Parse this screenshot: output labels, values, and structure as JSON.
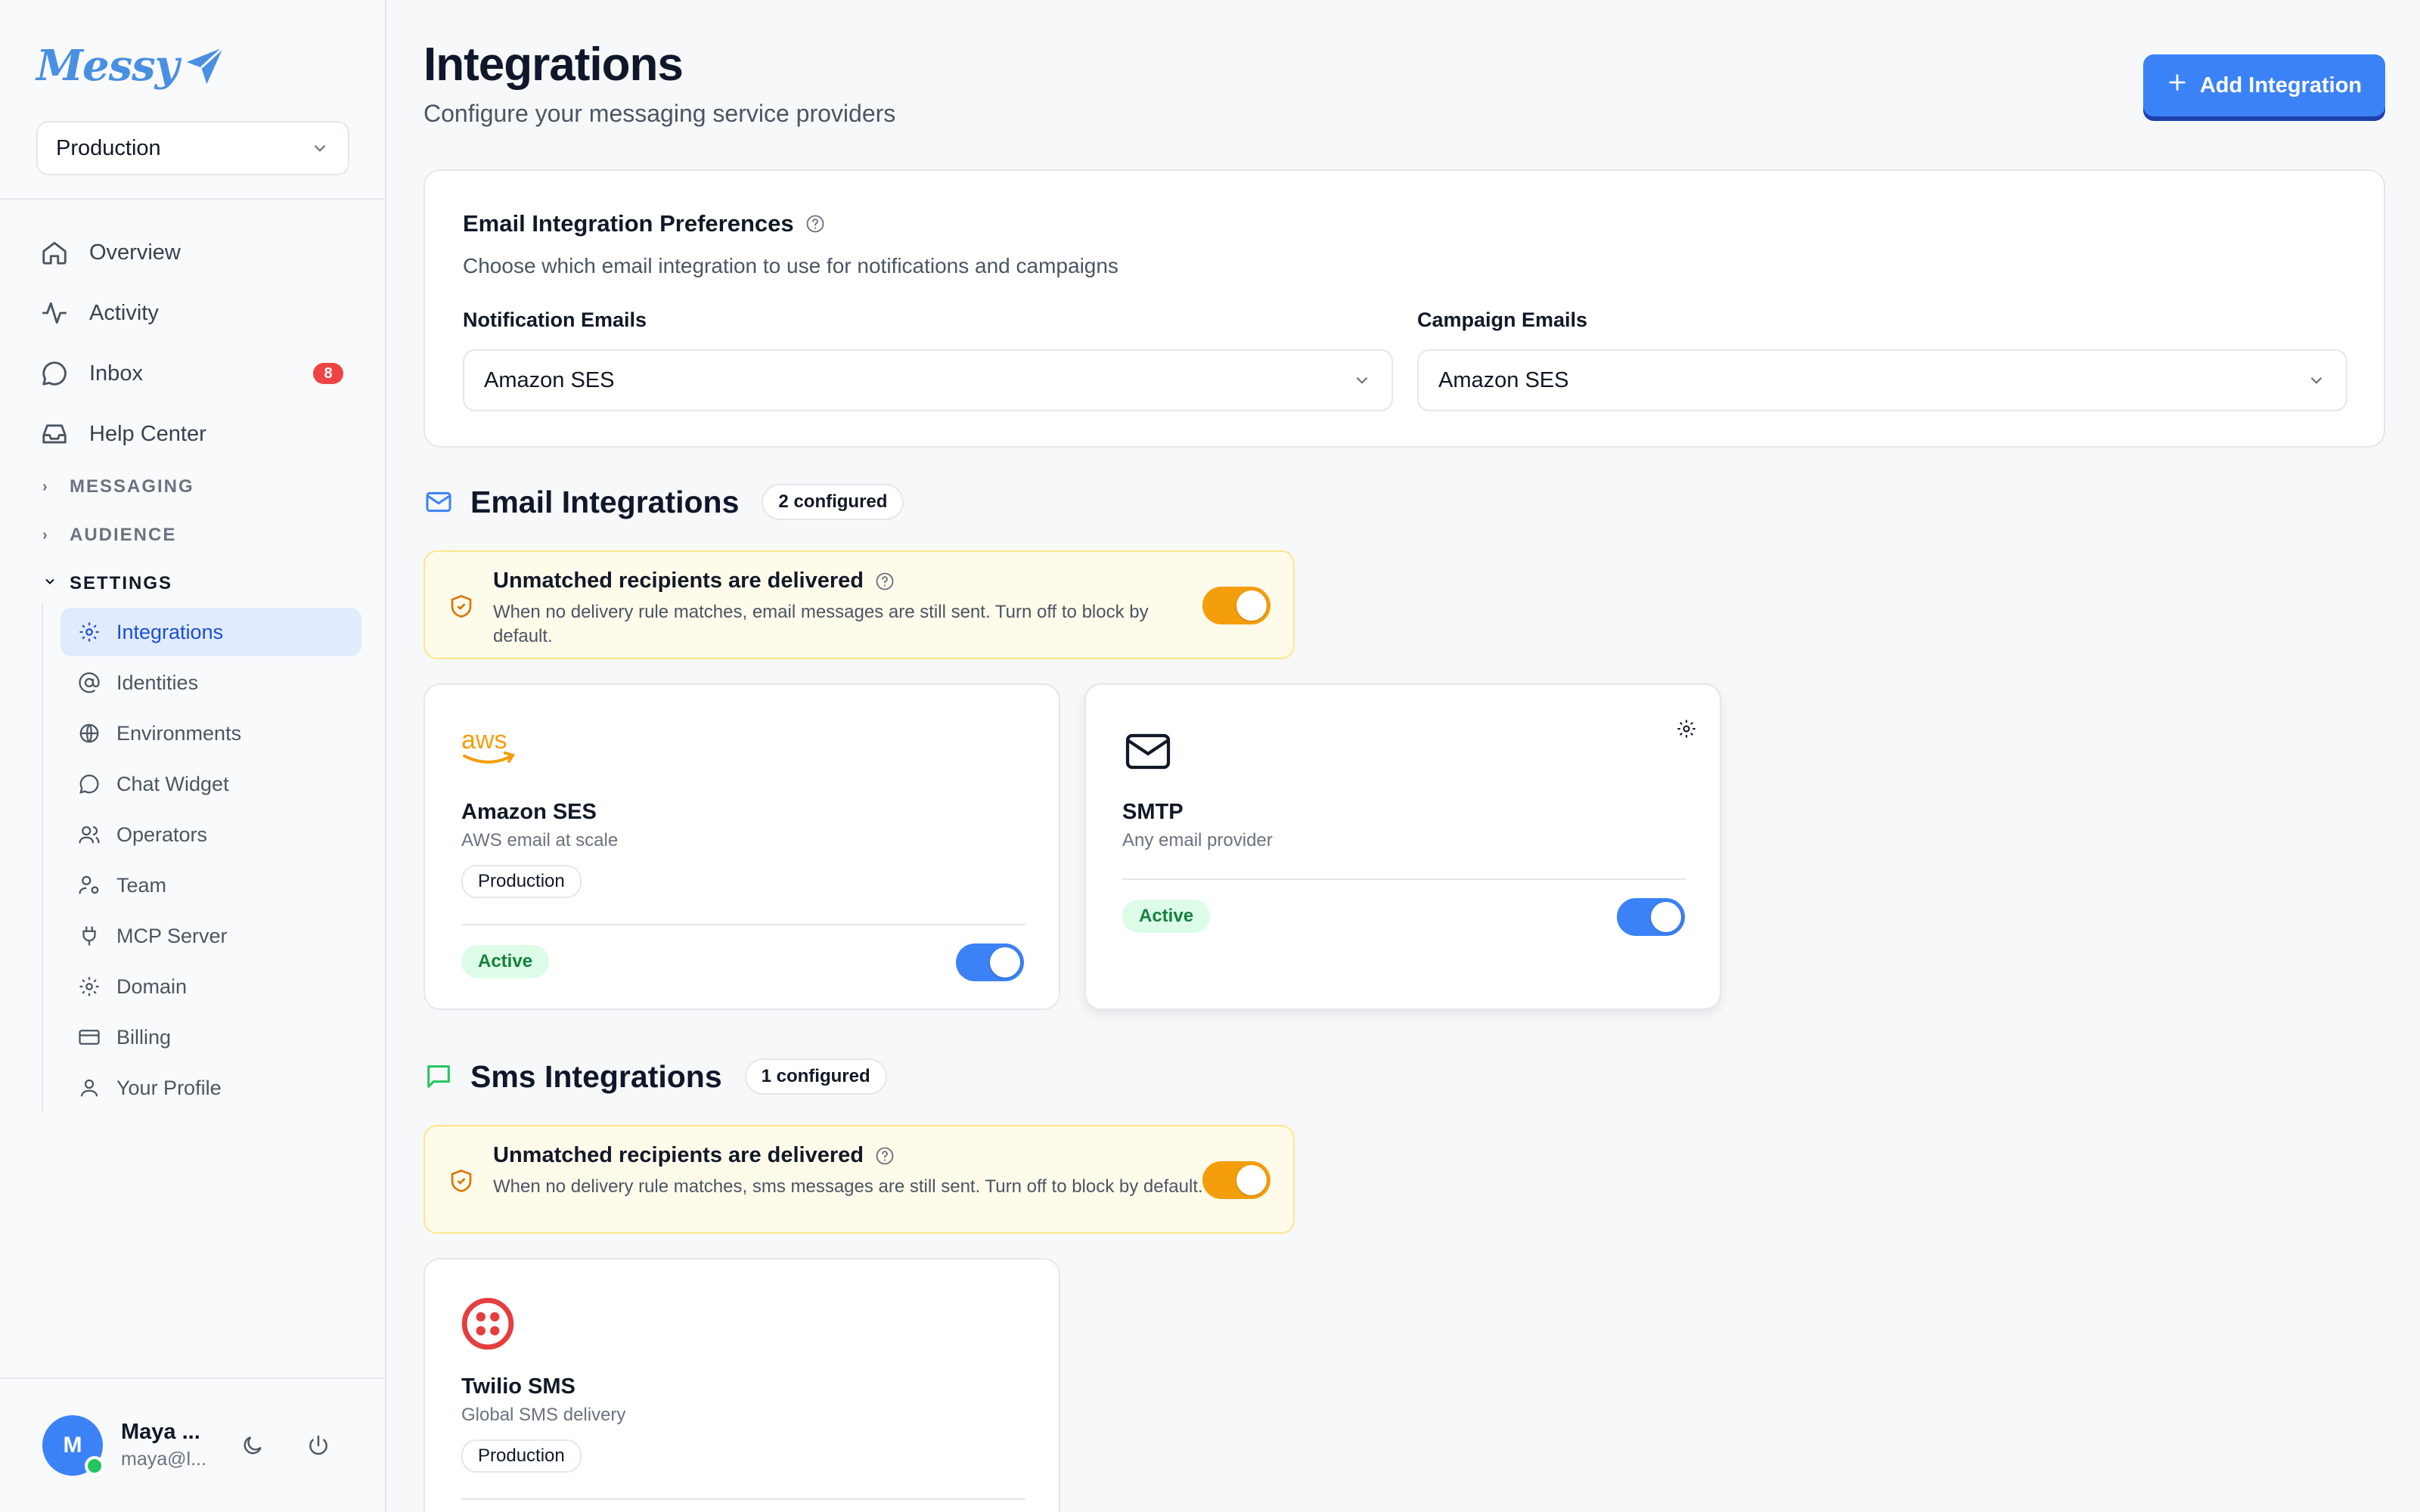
{
  "brand": {
    "name": "Messy"
  },
  "sidebar": {
    "env_select": "Production",
    "main_items": [
      {
        "label": "Overview",
        "icon": "home-icon"
      },
      {
        "label": "Activity",
        "icon": "activity-icon"
      },
      {
        "label": "Inbox",
        "icon": "chat-bubble-icon",
        "badge": "8"
      },
      {
        "label": "Help Center",
        "icon": "inbox-tray-icon"
      }
    ],
    "sections": [
      {
        "label": "MESSAGING",
        "expanded": false
      },
      {
        "label": "AUDIENCE",
        "expanded": false
      },
      {
        "label": "SETTINGS",
        "expanded": true
      }
    ],
    "settings_items": [
      {
        "label": "Integrations",
        "icon": "gear-icon",
        "active": true
      },
      {
        "label": "Identities",
        "icon": "at-sign-icon"
      },
      {
        "label": "Environments",
        "icon": "globe-icon"
      },
      {
        "label": "Chat Widget",
        "icon": "chat-bubble-icon"
      },
      {
        "label": "Operators",
        "icon": "users-icon"
      },
      {
        "label": "Team",
        "icon": "user-key-icon"
      },
      {
        "label": "MCP Server",
        "icon": "plug-icon"
      },
      {
        "label": "Domain",
        "icon": "gear-icon"
      },
      {
        "label": "Billing",
        "icon": "credit-card-icon"
      },
      {
        "label": "Your Profile",
        "icon": "user-icon"
      }
    ],
    "user": {
      "initial": "M",
      "name": "Maya ...",
      "email": "maya@l..."
    }
  },
  "header": {
    "title": "Integrations",
    "subtitle": "Configure your messaging service providers",
    "add_button": "Add Integration"
  },
  "preferences": {
    "title": "Email Integration Preferences",
    "subtitle": "Choose which email integration to use for notifications and campaigns",
    "notification_label": "Notification Emails",
    "notification_value": "Amazon SES",
    "campaign_label": "Campaign Emails",
    "campaign_value": "Amazon SES"
  },
  "email_group": {
    "title": "Email Integrations",
    "count": "2 configured",
    "notice_title": "Unmatched recipients are delivered",
    "notice_desc": "When no delivery rule matches, email messages are still sent. Turn off to block by default.",
    "notice_toggle_on": true,
    "providers": [
      {
        "name": "Amazon SES",
        "desc": "AWS email at scale",
        "env": "Production",
        "status": "Active",
        "enabled": true,
        "logo": "aws"
      },
      {
        "name": "SMTP",
        "desc": "Any email provider",
        "status": "Active",
        "enabled": true,
        "icon": "mail-icon"
      }
    ]
  },
  "sms_group": {
    "title": "Sms Integrations",
    "count": "1 configured",
    "notice_title": "Unmatched recipients are delivered",
    "notice_desc": "When no delivery rule matches, sms messages are still sent. Turn off to block by default.",
    "notice_toggle_on": true,
    "providers": [
      {
        "name": "Twilio SMS",
        "desc": "Global SMS delivery",
        "env": "Production",
        "icon": "twilio-icon"
      }
    ]
  },
  "colors": {
    "accent": "#3b82f6",
    "warning": "#f59e0b",
    "success_bg": "#dcfce7",
    "success_text": "#15803d",
    "twilio": "#e53e3e",
    "aws": "#f59e0b"
  }
}
